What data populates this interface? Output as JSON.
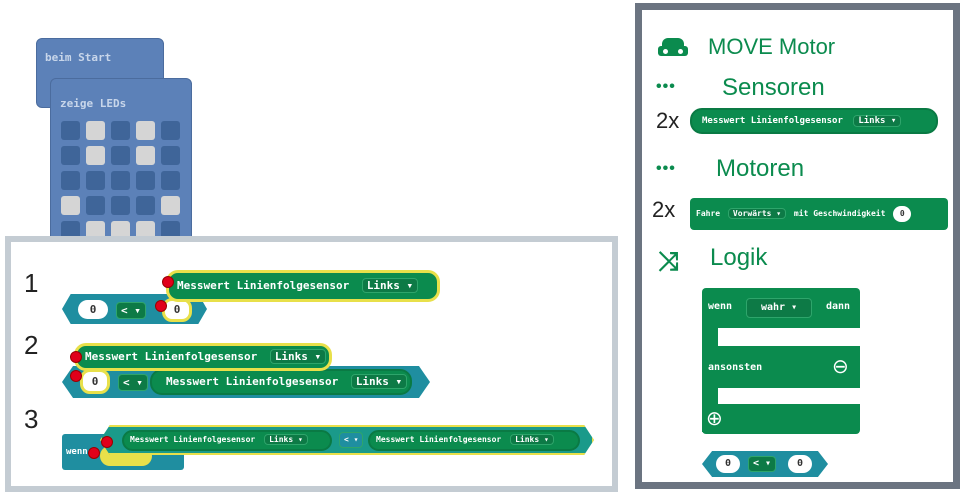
{
  "workspace": {
    "on_start": "beim Start",
    "show_leds": "zeige LEDs",
    "leds": [
      [
        0,
        1,
        0,
        1,
        0
      ],
      [
        0,
        1,
        0,
        1,
        0
      ],
      [
        0,
        0,
        0,
        0,
        0
      ],
      [
        1,
        0,
        0,
        0,
        1
      ],
      [
        0,
        1,
        1,
        1,
        0
      ]
    ]
  },
  "steps": {
    "s1": "1",
    "s2": "2",
    "s3": "3"
  },
  "blocks": {
    "sensor": "Messwert Linienfolgesensor",
    "side": "Links",
    "lt": "<",
    "zero": "0",
    "if_short": "wenn",
    "drive": "Fahre",
    "fwd": "Vorwärts",
    "speed": "mit Geschwindigkeit"
  },
  "panel": {
    "move_motor": "MOVE Motor",
    "sensors": "Sensoren",
    "motors": "Motoren",
    "logic": "Logik",
    "count_sensor": "2x",
    "count_drive": "2x",
    "if_label": "wenn",
    "true_label": "wahr",
    "then_label": "dann",
    "else_label": "ansonsten",
    "minus_icon": "⊖",
    "plus_icon": "⊕",
    "dots_icon": "•••",
    "car_icon": "🚗",
    "shuffle_icon": "⤨"
  },
  "colors": {
    "green": "#0b8b4e",
    "teal": "#1f8ea0",
    "blue": "#5c81b8",
    "highlight": "#e8e04a",
    "marker": "#e0001a"
  }
}
